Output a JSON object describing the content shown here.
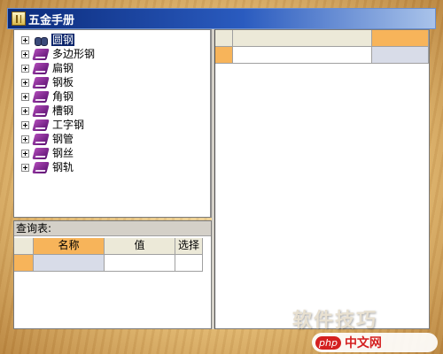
{
  "window": {
    "title": "五金手册"
  },
  "tree": {
    "items": [
      {
        "label": "圆钢",
        "icon": "binoculars-icon",
        "selected": true
      },
      {
        "label": "多边形钢",
        "icon": "book-icon"
      },
      {
        "label": "扁钢",
        "icon": "book-icon"
      },
      {
        "label": "钢板",
        "icon": "book-icon"
      },
      {
        "label": "角钢",
        "icon": "book-icon"
      },
      {
        "label": "槽钢",
        "icon": "book-icon"
      },
      {
        "label": "工字钢",
        "icon": "book-icon"
      },
      {
        "label": "钢管",
        "icon": "book-icon"
      },
      {
        "label": "钢丝",
        "icon": "book-icon"
      },
      {
        "label": "钢轨",
        "icon": "book-icon"
      }
    ]
  },
  "query": {
    "label": "查询表:",
    "columns": [
      "名称",
      "值",
      "选择"
    ]
  },
  "watermark": {
    "text": "软件技巧",
    "logo_php": "php",
    "logo_site": "中文网"
  },
  "colors": {
    "accent": "#f7b45a",
    "selection": "#0a246a",
    "titlebar": "#0a2a7a"
  }
}
